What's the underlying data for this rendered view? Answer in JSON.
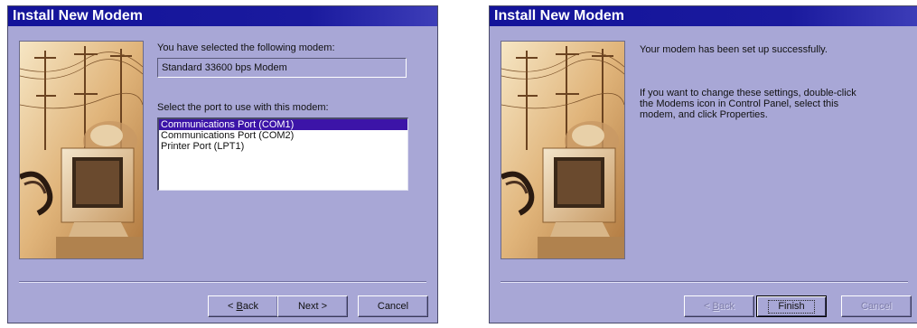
{
  "left_dialog": {
    "title": "Install New Modem",
    "selected_modem_prompt": "You have selected the following modem:",
    "modem_name": "Standard 33600 bps Modem",
    "port_prompt": "Select the port to use with this modem:",
    "ports": [
      {
        "label": "Communications Port (COM1)",
        "selected": true
      },
      {
        "label": "Communications Port (COM2)",
        "selected": false
      },
      {
        "label": "Printer Port (LPT1)",
        "selected": false
      }
    ],
    "back_prefix": "< ",
    "back_key": "B",
    "back_rest": "ack",
    "next_label": "Next >",
    "cancel_label": "Cancel"
  },
  "right_dialog": {
    "title": "Install New Modem",
    "success_message": "Your modem has been set up successfully.",
    "info_line_1": "If you want to change these settings, double-click",
    "info_line_2": "the Modems icon in Control Panel, select this",
    "info_line_3": "modem, and click Properties.",
    "back_prefix": "< ",
    "back_key": "B",
    "back_rest": "ack",
    "finish_label": "Finish",
    "cancel_label": "Cancel"
  },
  "colors": {
    "dialog_bg": "#a8a7d6",
    "titlebar": "#13139a",
    "selection": "#3c14a8"
  },
  "icons": {
    "wizard_art": "telephone-poles-computer-art"
  }
}
